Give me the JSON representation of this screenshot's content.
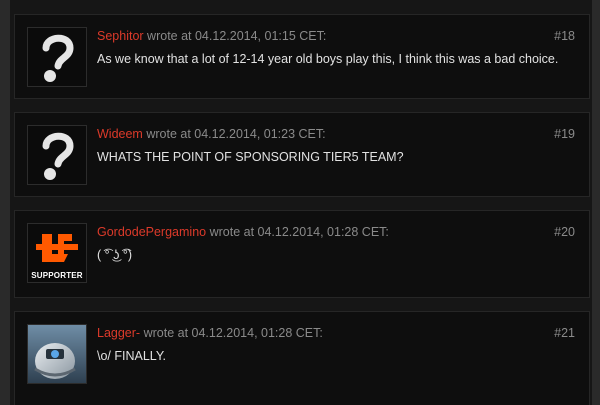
{
  "posts": [
    {
      "author": "Sephitor",
      "meta": "wrote at 04.12.2014, 01:15 CET:",
      "number": "#18",
      "text": "As we know that a lot of 12-14 year old boys play this, I think this was a bad choice.",
      "avatar_icon": "question-mark-icon"
    },
    {
      "author": "Wideem",
      "meta": "wrote at 04.12.2014, 01:23 CET:",
      "number": "#19",
      "text": "WHATS THE POINT OF SPONSORING TIER5 TEAM?",
      "avatar_icon": "question-mark-icon"
    },
    {
      "author": "GordodePergamino",
      "meta": "wrote at 04.12.2014, 01:28 CET:",
      "number": "#20",
      "text": "( ͡° ͜ʖ ͡°)",
      "avatar_icon": "fnatic-logo-icon",
      "avatar_label": "SUPPORTER"
    },
    {
      "author": "Lagger-",
      "meta": "wrote at 04.12.2014, 01:28 CET:",
      "number": "#21",
      "text": "\\o/ FINALLY.",
      "avatar_icon": "robot-portrait-icon"
    }
  ],
  "colors": {
    "author": "#dc3a2a",
    "meta": "#8a8a8a",
    "text": "#e2e2e2",
    "brand_orange": "#ff5900"
  }
}
